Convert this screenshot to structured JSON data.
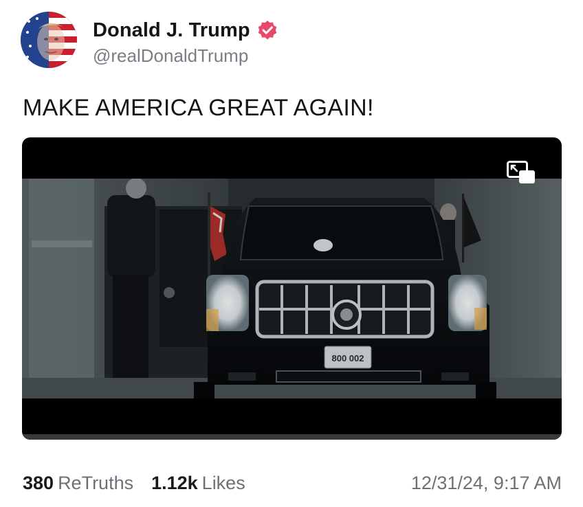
{
  "author": {
    "display_name": "Donald J. Trump",
    "handle": "@realDonaldTrump",
    "verified_icon": "verified-badge-icon",
    "accent_color": "#e8486a"
  },
  "post": {
    "text": "MAKE AMERICA GREAT AGAIN!",
    "media": {
      "type": "video",
      "plate_text": "800 002",
      "progress": 0.0
    }
  },
  "stats": {
    "retruths_count": "380",
    "retruths_label": "ReTruths",
    "likes_count": "1.12k",
    "likes_label": "Likes",
    "timestamp": "12/31/24, 9:17 AM"
  }
}
